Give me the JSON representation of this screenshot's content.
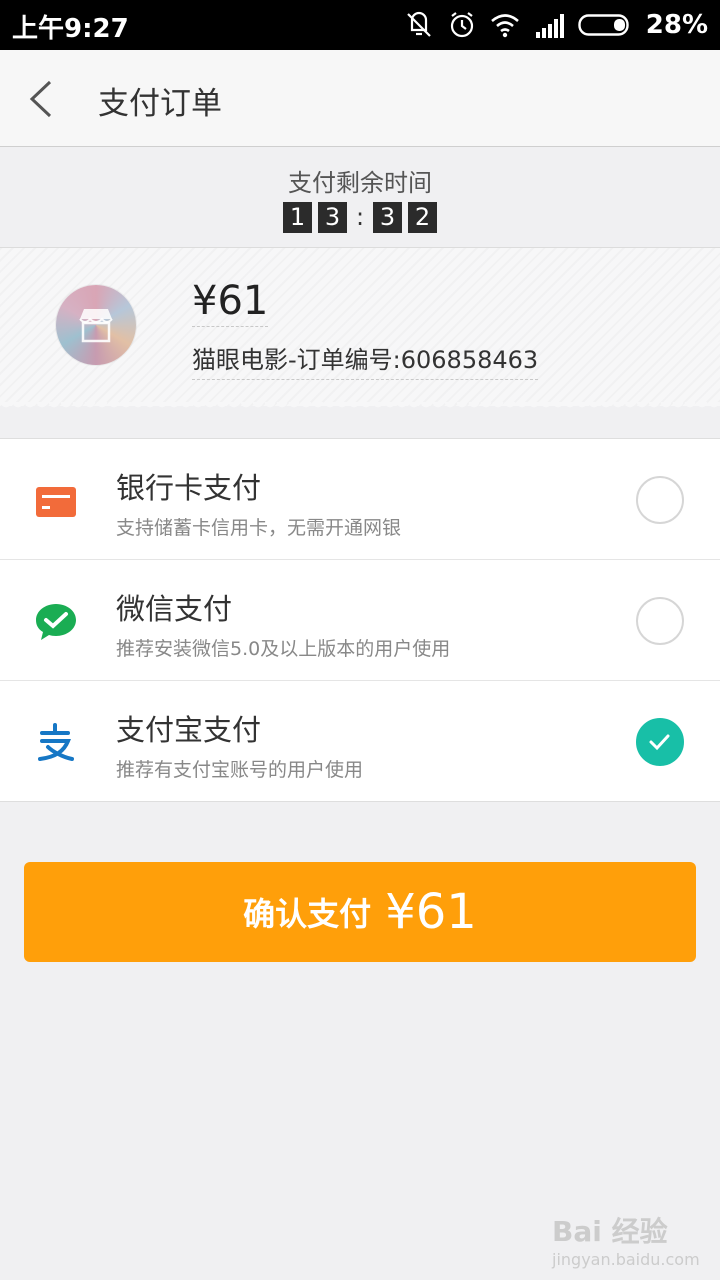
{
  "status_bar": {
    "time": "上午9:27",
    "battery_percent": "28%",
    "icons": [
      "vibrate-off-icon",
      "alarm-icon",
      "wifi-icon",
      "signal-icon",
      "battery-icon"
    ]
  },
  "header": {
    "title": "支付订单",
    "back_icon": "chevron-left-icon"
  },
  "timer": {
    "label": "支付剩余时间",
    "digits": [
      "1",
      "3",
      "3",
      "2"
    ],
    "separator": ":"
  },
  "order": {
    "amount": "¥61",
    "description": "猫眼电影-订单编号:606858463",
    "avatar_icon": "store-icon"
  },
  "payment_methods": [
    {
      "title": "银行卡支付",
      "subtitle": "支持储蓄卡信用卡，无需开通网银",
      "icon": "bank-card-icon",
      "icon_color": "#f26b3a",
      "selected": false
    },
    {
      "title": "微信支付",
      "subtitle": "推荐安装微信5.0及以上版本的用户使用",
      "icon": "wechat-pay-icon",
      "icon_color": "#1aad53",
      "selected": false
    },
    {
      "title": "支付宝支付",
      "subtitle": "推荐有支付宝账号的用户使用",
      "icon": "alipay-icon",
      "icon_color": "#1677c5",
      "selected": true
    }
  ],
  "confirm": {
    "label": "确认支付",
    "amount": "¥61",
    "color": "#ff9f0a"
  },
  "watermark": {
    "text": "Bai 经验",
    "url": "jingyan.baidu.com"
  },
  "colors": {
    "accent_check": "#18bfa7",
    "background": "#f0f0f2"
  }
}
